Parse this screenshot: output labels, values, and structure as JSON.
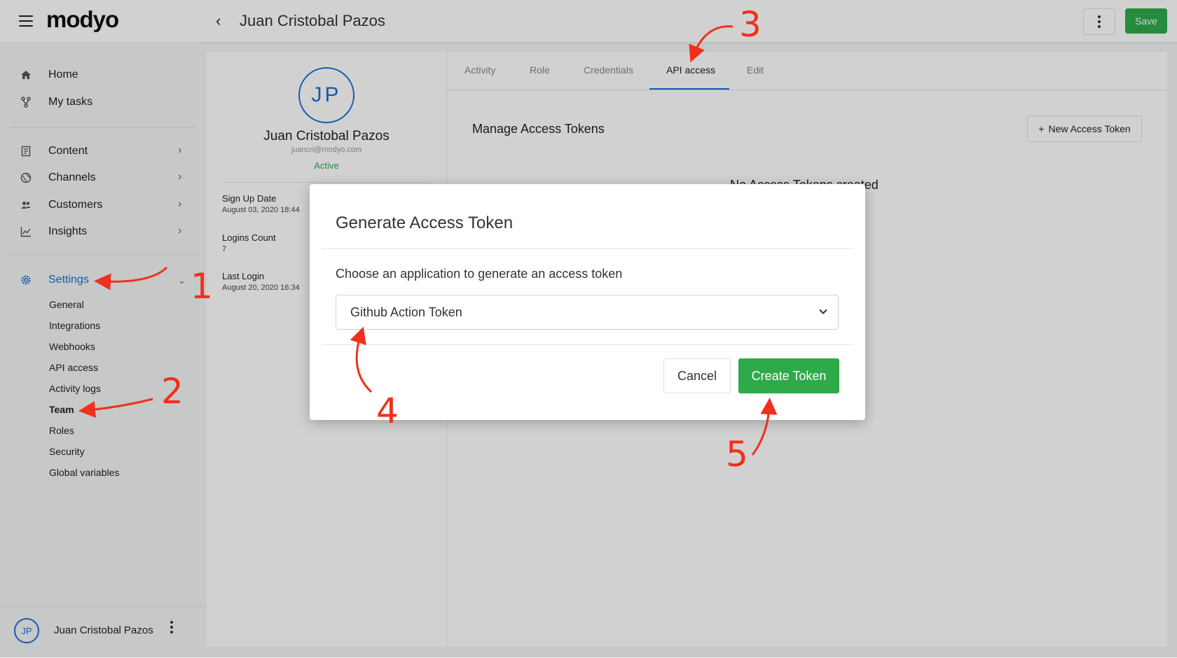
{
  "header": {
    "logo_text": "modyo",
    "page_title": "Juan Cristobal Pazos",
    "save_label": "Save"
  },
  "sidebar": {
    "items": [
      {
        "label": "Home",
        "icon": "home-icon"
      },
      {
        "label": "My tasks",
        "icon": "branch-icon"
      },
      {
        "label": "Content",
        "icon": "document-icon"
      },
      {
        "label": "Channels",
        "icon": "globe-icon"
      },
      {
        "label": "Customers",
        "icon": "users-icon"
      },
      {
        "label": "Insights",
        "icon": "chart-icon"
      },
      {
        "label": "Settings",
        "icon": "gear-icon"
      }
    ],
    "settings_subitems": [
      "General",
      "Integrations",
      "Webhooks",
      "API access",
      "Activity logs",
      "Team",
      "Roles",
      "Security",
      "Global variables"
    ],
    "active_subitem": "Team",
    "footer_user": {
      "initials": "JP",
      "name": "Juan Cristobal Pazos"
    }
  },
  "profile": {
    "initials": "JP",
    "name": "Juan Cristobal Pazos",
    "email": "juancri@modyo.com",
    "status": "Active",
    "details": [
      {
        "label": "Sign Up Date",
        "value": "August 03, 2020 18:44"
      },
      {
        "label": "Logins Count",
        "value": "7"
      },
      {
        "label": "Last Login",
        "value": "August 20, 2020 16:34"
      }
    ]
  },
  "main": {
    "tabs": [
      "Activity",
      "Role",
      "Credentials",
      "API access",
      "Edit"
    ],
    "active_tab": "API access",
    "section_title": "Manage Access Tokens",
    "new_token_label": "New Access Token",
    "empty_text": "No Access Tokens created"
  },
  "modal": {
    "title": "Generate Access Token",
    "prompt": "Choose an application to generate an access token",
    "selected_application": "Github Action Token",
    "cancel_label": "Cancel",
    "create_label": "Create Token"
  },
  "annotations": [
    "1",
    "2",
    "3",
    "4",
    "5"
  ],
  "colors": {
    "accent_blue": "#1a6fd6",
    "brand_green": "#2eaa4b",
    "annotation_red": "#f0301c"
  }
}
